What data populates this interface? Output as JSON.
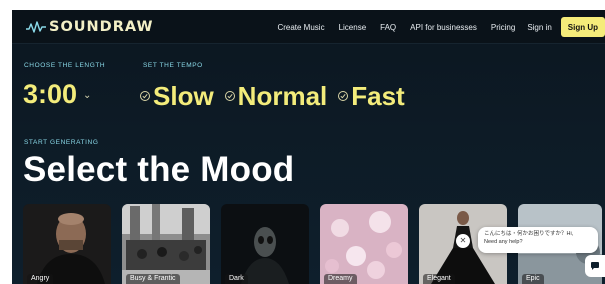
{
  "header": {
    "logo_text": "SOUNDRAW",
    "nav": [
      "Create Music",
      "License",
      "FAQ",
      "API for businesses",
      "Pricing",
      "Sign in"
    ],
    "signup_label": "Sign Up"
  },
  "length": {
    "label": "CHOOSE THE LENGTH",
    "value": "3:00"
  },
  "tempo": {
    "label": "SET THE TEMPO",
    "options": [
      "Slow",
      "Normal",
      "Fast"
    ]
  },
  "generate": {
    "label": "START GENERATING",
    "title": "Select the Mood"
  },
  "moods": [
    "Angry",
    "Busy & Frantic",
    "Dark",
    "Dreamy",
    "Elegant",
    "Epic"
  ],
  "chat": {
    "line1": "こんにちは・何かお困りですか？Hi,",
    "line2": "Need any help?"
  },
  "colors": {
    "accent": "#f3ec7b",
    "label": "#8ad9e8",
    "background": "#0d1b26"
  }
}
